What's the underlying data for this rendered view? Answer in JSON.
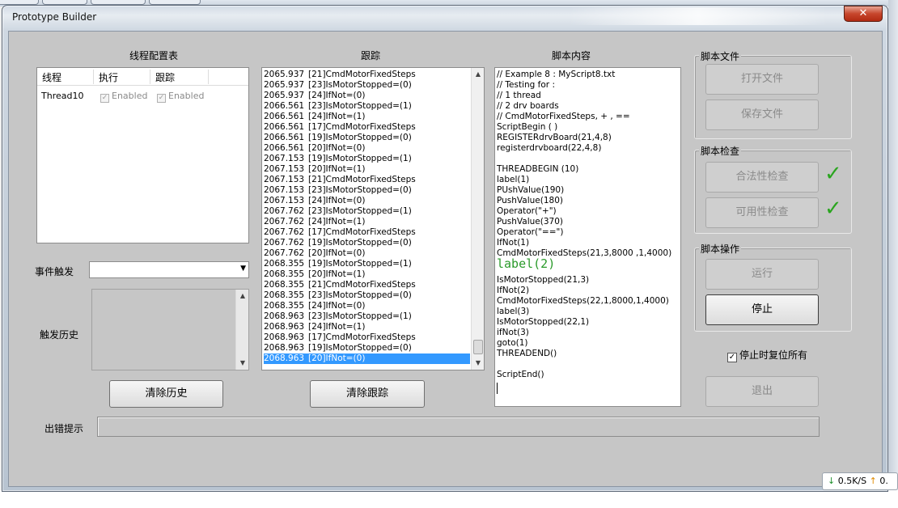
{
  "window": {
    "title": "Prototype Builder",
    "close_glyph": "✕"
  },
  "thread_config": {
    "title": "线程配置表",
    "columns": [
      "线程",
      "执行",
      "跟踪"
    ],
    "rows": [
      {
        "thread": "Thread10",
        "execute": "Enabled",
        "trace": "Enabled"
      }
    ]
  },
  "event_trigger": {
    "label": "事件触发",
    "value": ""
  },
  "trigger_history": {
    "label": "触发历史"
  },
  "buttons": {
    "clear_history": "清除历史",
    "clear_trace": "清除跟踪",
    "open_file": "打开文件",
    "save_file": "保存文件",
    "validity_check": "合法性检查",
    "usability_check": "可用性检查",
    "run": "运行",
    "stop": "停止",
    "exit": "退出"
  },
  "trace": {
    "title": "跟踪",
    "rows": [
      [
        "2065.937",
        "[21]CmdMotorFixedSteps"
      ],
      [
        "2065.937",
        "[23]IsMotorStopped=(0)"
      ],
      [
        "2065.937",
        "[24]IfNot=(0)"
      ],
      [
        "2066.561",
        "[23]IsMotorStopped=(1)"
      ],
      [
        "2066.561",
        "[24]IfNot=(1)"
      ],
      [
        "2066.561",
        "[17]CmdMotorFixedSteps"
      ],
      [
        "2066.561",
        "[19]IsMotorStopped=(0)"
      ],
      [
        "2066.561",
        "[20]IfNot=(0)"
      ],
      [
        "2067.153",
        "[19]IsMotorStopped=(1)"
      ],
      [
        "2067.153",
        "[20]IfNot=(1)"
      ],
      [
        "2067.153",
        "[21]CmdMotorFixedSteps"
      ],
      [
        "2067.153",
        "[23]IsMotorStopped=(0)"
      ],
      [
        "2067.153",
        "[24]IfNot=(0)"
      ],
      [
        "2067.762",
        "[23]IsMotorStopped=(1)"
      ],
      [
        "2067.762",
        "[24]IfNot=(1)"
      ],
      [
        "2067.762",
        "[17]CmdMotorFixedSteps"
      ],
      [
        "2067.762",
        "[19]IsMotorStopped=(0)"
      ],
      [
        "2067.762",
        "[20]IfNot=(0)"
      ],
      [
        "2068.355",
        "[19]IsMotorStopped=(1)"
      ],
      [
        "2068.355",
        "[20]IfNot=(1)"
      ],
      [
        "2068.355",
        "[21]CmdMotorFixedSteps"
      ],
      [
        "2068.355",
        "[23]IsMotorStopped=(0)"
      ],
      [
        "2068.355",
        "[24]IfNot=(0)"
      ],
      [
        "2068.963",
        "[23]IsMotorStopped=(1)"
      ],
      [
        "2068.963",
        "[24]IfNot=(1)"
      ],
      [
        "2068.963",
        "[17]CmdMotorFixedSteps"
      ],
      [
        "2068.963",
        "[19]IsMotorStopped=(0)"
      ],
      [
        "2068.963",
        "[20]IfNot=(0)"
      ]
    ],
    "selected_index": 27
  },
  "script": {
    "title": "脚本内容",
    "lines": [
      "// Example 8 : MyScript8.txt",
      "// Testing for :",
      "//     1 thread",
      "//     2 drv boards",
      "//     CmdMotorFixedSteps, + , ==",
      "ScriptBegin ( )",
      "REGISTERdrvBoard(21,4,8)",
      "registerdrvboard(22,4,8)",
      "",
      "THREADBEGIN (10)",
      "label(1)",
      "PUshValue(190)",
      "PushValue(180)",
      "Operator(\"+\")",
      "PushValue(370)",
      "Operator(\"==\")",
      "IfNot(1)",
      "CmdMotorFixedSteps(21,3,8000 ,1,4000)",
      "label(2)",
      "IsMotorStopped(21,3)",
      "IfNot(2)",
      "CmdMotorFixedSteps(22,1,8000,1,4000)",
      "label(3)",
      "IsMotorStopped(22,1)",
      "ifNot(3)",
      "goto(1)",
      "THREADEND()",
      "",
      "ScriptEnd()"
    ],
    "highlight_index": 18
  },
  "groups": {
    "script_file": "脚本文件",
    "script_check": "脚本检查",
    "script_ops": "脚本操作"
  },
  "reset_on_stop": {
    "label": "停止时复位所有",
    "checked": true
  },
  "error_hint": {
    "label": "出错提示",
    "value": ""
  },
  "net_speed": {
    "down": "0.5K/S",
    "up": "0."
  },
  "colors": {
    "check_ok": "#2aa51f",
    "selection": "#3399ff",
    "close": "#c7462c"
  }
}
